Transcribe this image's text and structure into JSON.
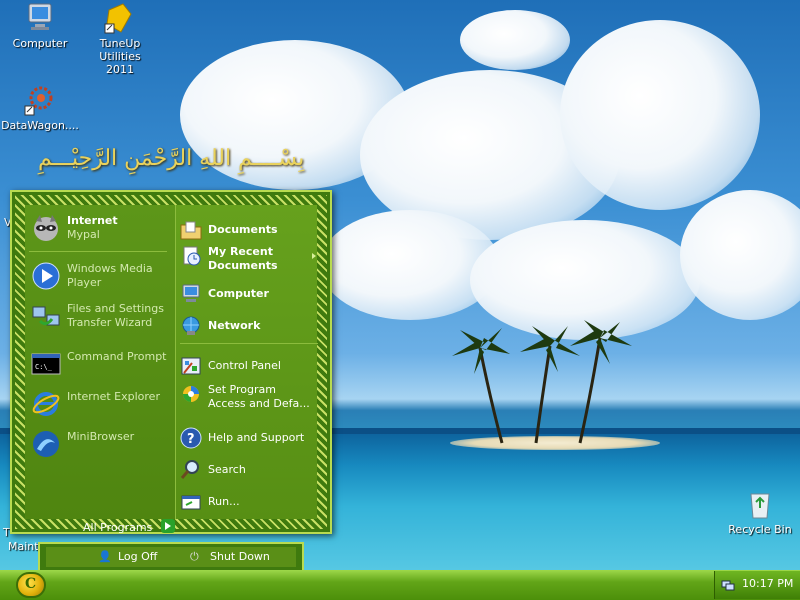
{
  "desktop": {
    "calligraphy": "بِسْــــمِ اللهِ الرَّحْمَنِ الرَّحِيْـــمِ",
    "icons": [
      {
        "label": "Computer",
        "icon": "computer-icon"
      },
      {
        "label": "TuneUp Utilities\n2011",
        "icon": "tuneup-icon"
      },
      {
        "label": "DataWagon....",
        "icon": "datawagon-icon"
      },
      {
        "label": "Recycle Bin",
        "icon": "recycle-bin-icon"
      }
    ],
    "partial_labels": {
      "v": "V",
      "t": "T",
      "maint": "Maint"
    }
  },
  "start_menu": {
    "pinned": [
      {
        "title": "Internet",
        "subtitle": "Mypal",
        "icon": "mypal-raccoon-icon"
      }
    ],
    "recent": [
      {
        "label": "Windows Media Player",
        "icon": "windows-media-player-icon"
      },
      {
        "label": "Files and Settings Transfer Wizard",
        "icon": "transfer-wizard-icon"
      },
      {
        "label": "Command Prompt",
        "icon": "command-prompt-icon"
      },
      {
        "label": "Internet Explorer",
        "icon": "internet-explorer-icon"
      },
      {
        "label": "MiniBrowser",
        "icon": "minibrowser-icon"
      }
    ],
    "all_programs": "All Programs",
    "places": [
      {
        "label": "Documents",
        "icon": "documents-folder-icon"
      },
      {
        "label": "My Recent Documents",
        "icon": "recent-documents-icon"
      },
      {
        "label": "Computer",
        "icon": "computer-icon"
      },
      {
        "label": "Network",
        "icon": "network-icon"
      }
    ],
    "system": [
      {
        "label": "Control Panel",
        "icon": "control-panel-icon"
      },
      {
        "label": "Set Program Access and Defa...",
        "icon": "set-program-access-icon"
      },
      {
        "label": "Help and Support",
        "icon": "help-icon"
      },
      {
        "label": "Search",
        "icon": "search-icon"
      },
      {
        "label": "Run...",
        "icon": "run-icon"
      }
    ],
    "log_off": "Log Off",
    "shut_down": "Shut Down"
  },
  "taskbar": {
    "clock": "10:17 PM",
    "start_label": "C"
  },
  "colors": {
    "menu_green": "#5a8f17",
    "menu_border": "#b9db50",
    "taskbar_green": "#62a518"
  }
}
